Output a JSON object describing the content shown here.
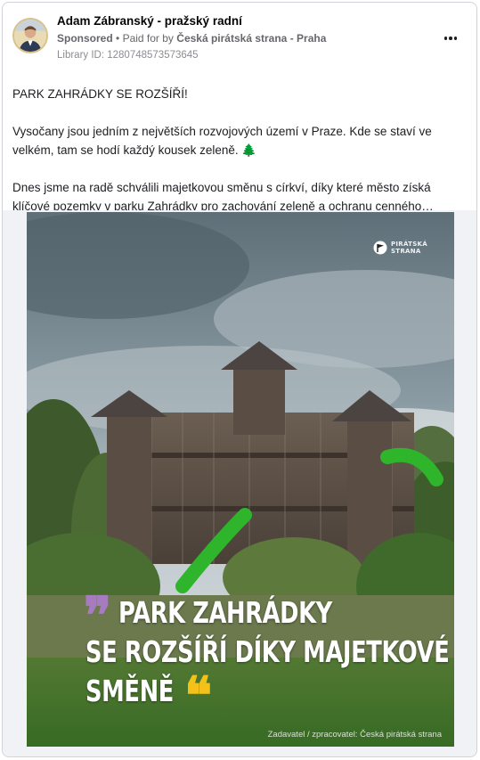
{
  "post": {
    "page_name": "Adam Zábranský - pražský radní",
    "sponsored_label": "Sponsored",
    "paid_for_prefix": "Paid for by",
    "advertiser": "Česká pirátská strana - Praha",
    "library_id": "Library ID: 1280748573573645",
    "paragraphs": [
      "PARK ZAHRÁDKY SE ROZŠÍŘÍ!",
      "Vysočany jsou jedním z největších rozvojových území v Praze. Kde se staví ve velkém, tam se hodí každý kousek zeleně.",
      "Dnes jsme na radě schválili majetkovou směnu s církví, díky které město získá klíčové pozemky v parku Zahrádky pro zachování zeleně a ochranu cenného…"
    ],
    "tree_emoji": "🌲"
  },
  "media": {
    "overlay_lines": [
      "PARK ZAHRÁDKY",
      "SE ROZŠÍŘÍ DÍKY MAJETKOVÉ",
      "SMĚNĚ"
    ],
    "quote_open": "❞",
    "quote_close": "❝",
    "brand_line1": "PIRÁTSKÁ",
    "brand_line2": "STRANA",
    "credit": "Zadavatel / zpracovatel: Česká pirátská strana",
    "colors": {
      "quote_open": "#a77bbf",
      "quote_close": "#f2c21a",
      "slide_green": "#2fb52b"
    }
  }
}
